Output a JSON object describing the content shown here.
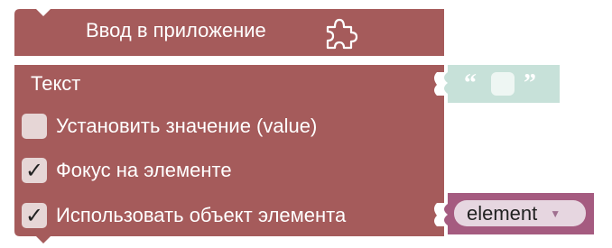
{
  "block": {
    "title": "Ввод в приложение",
    "color": "#a55b5b",
    "fields": {
      "text_label": "Текст",
      "set_value_label": "Установить значение (value)",
      "focus_label": "Фокус на элементе",
      "use_element_label": "Использовать объект элемента"
    },
    "checkboxes": {
      "set_value": false,
      "focus": true,
      "use_element": true,
      "check_glyph": "✓"
    }
  },
  "text_block": {
    "color": "#c7e1d9",
    "quote_open": "“",
    "quote_close": "”",
    "value": ""
  },
  "variable_block": {
    "color": "#a55b80",
    "value": "element",
    "arrow": "▼"
  },
  "icons": {
    "puzzle": "puzzle-icon"
  }
}
